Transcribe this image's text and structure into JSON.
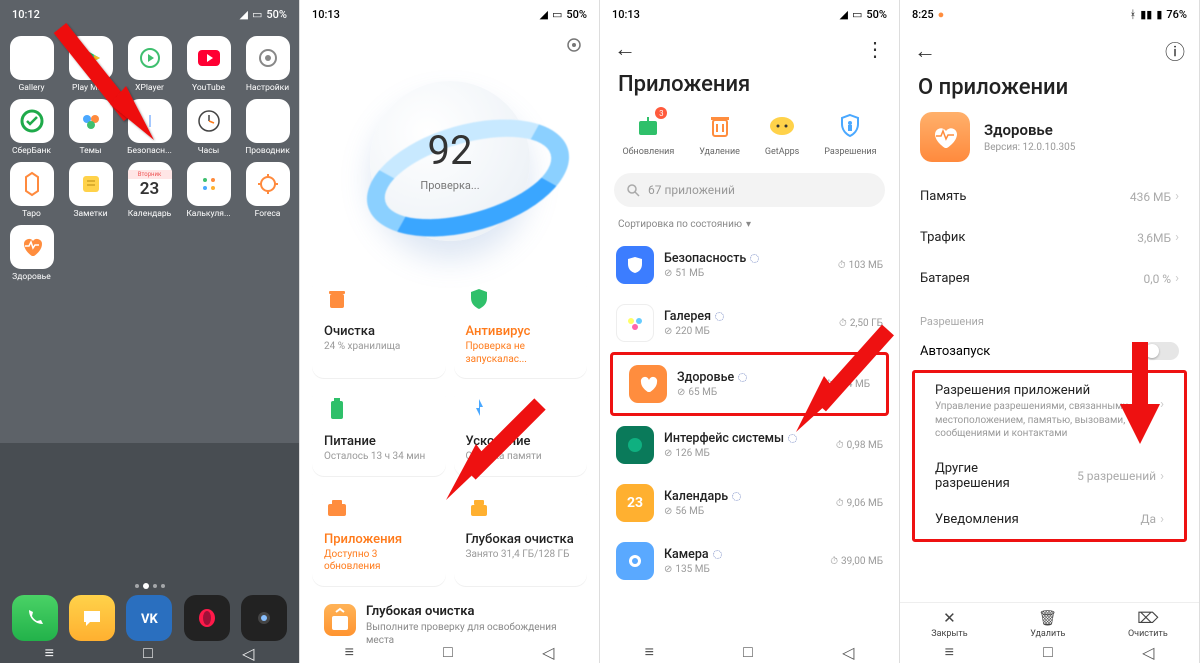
{
  "panel1": {
    "time": "10:12",
    "battery": "50%",
    "apps": [
      {
        "id": "gallery",
        "label": "Gallery"
      },
      {
        "id": "play",
        "label": "Play Ма..."
      },
      {
        "id": "xplayer",
        "label": "XPlayer"
      },
      {
        "id": "youtube",
        "label": "YouTube"
      },
      {
        "id": "settings",
        "label": "Настройки"
      },
      {
        "id": "sber",
        "label": "СберБанк"
      },
      {
        "id": "themes",
        "label": "Темы"
      },
      {
        "id": "security",
        "label": "Безопасн..."
      },
      {
        "id": "clock",
        "label": "Часы"
      },
      {
        "id": "files",
        "label": "Проводник"
      },
      {
        "id": "taro",
        "label": "Таро"
      },
      {
        "id": "notes",
        "label": "Заметки"
      },
      {
        "id": "calendar",
        "label": "Календарь",
        "badge": "Вторник",
        "day": "23"
      },
      {
        "id": "calc",
        "label": "Калькуля..."
      },
      {
        "id": "foreca",
        "label": "Foreca"
      },
      {
        "id": "health",
        "label": "Здоровье"
      }
    ],
    "dock": [
      "phone",
      "sms",
      "vk",
      "opera",
      "camera"
    ]
  },
  "panel2": {
    "time": "10:13",
    "battery": "50%",
    "score": "92",
    "scan": "Проверка...",
    "cards": [
      {
        "k": "clean",
        "title": "Очистка",
        "sub": "24 % хранилища"
      },
      {
        "k": "av",
        "title": "Антивирус",
        "sub": "Проверка не запускалас..."
      },
      {
        "k": "power",
        "title": "Питание",
        "sub": "Осталось 13 ч 34 мин"
      },
      {
        "k": "boost",
        "title": "Ускорение",
        "sub": "Очистка памяти"
      },
      {
        "k": "apps",
        "title": "Приложения",
        "sub": "Доступно 3 обновления"
      },
      {
        "k": "deep",
        "title": "Глубокая очистка",
        "sub": "Занято 31,4 ГБ/128 ГБ"
      }
    ],
    "big": {
      "title": "Глубокая очистка",
      "sub": "Выполните проверку для освобождения места"
    }
  },
  "panel3": {
    "time": "10:13",
    "battery": "50%",
    "title": "Приложения",
    "tiles": [
      {
        "k": "updates",
        "label": "Обновления",
        "badge": "3"
      },
      {
        "k": "uninstall",
        "label": "Удаление"
      },
      {
        "k": "getapps",
        "label": "GetApps"
      },
      {
        "k": "perms",
        "label": "Разрешения"
      }
    ],
    "search_placeholder": "67 приложений",
    "sort": "Сортировка по состоянию",
    "rows": [
      {
        "k": "sec",
        "name": "Безопасность",
        "storage": "51 МБ",
        "stats": "103 МБ",
        "color": "#3c7dff"
      },
      {
        "k": "gallery",
        "name": "Галерея",
        "storage": "220 МБ",
        "stats": "2,50 ГБ",
        "color": "#fff"
      },
      {
        "k": "health",
        "name": "Здоровье",
        "storage": "65 МБ",
        "stats": "434 МБ",
        "hl": true,
        "color": "#ff8d3e"
      },
      {
        "k": "sysui",
        "name": "Интерфейс системы",
        "storage": "126 МБ",
        "stats": "0,98 МБ",
        "color": "#0a7a5a"
      },
      {
        "k": "cal",
        "name": "Календарь",
        "storage": "56 МБ",
        "stats": "9,06 МБ",
        "color": "#ffb030",
        "day": "23"
      },
      {
        "k": "camera",
        "name": "Камера",
        "storage": "135 МБ",
        "stats": "39,00 МБ",
        "color": "#5aa9ff"
      }
    ]
  },
  "panel4": {
    "time": "8:25",
    "battery": "76%",
    "title": "О приложении",
    "app": {
      "name": "Здоровье",
      "ver": "Версия: 12.0.10.305"
    },
    "rows": [
      {
        "k": "mem",
        "label": "Память",
        "val": "436 МБ"
      },
      {
        "k": "traffic",
        "label": "Трафик",
        "val": "3,6МБ"
      },
      {
        "k": "battery",
        "label": "Батарея",
        "val": "0,0 %"
      }
    ],
    "section": "Разрешения",
    "autorun": "Автозапуск",
    "perm": {
      "title": "Разрешения приложений",
      "sub": "Управление разрешениями, связанными с местоположением, памятью, вызовами, сообщениями и контактами"
    },
    "other": {
      "label": "Другие разрешения",
      "val": "5 разрешений"
    },
    "notif": {
      "label": "Уведомления",
      "val": "Да"
    },
    "buttons": [
      {
        "k": "close",
        "label": "Закрыть"
      },
      {
        "k": "uninstall",
        "label": "Удалить"
      },
      {
        "k": "clear",
        "label": "Очистить"
      }
    ]
  }
}
